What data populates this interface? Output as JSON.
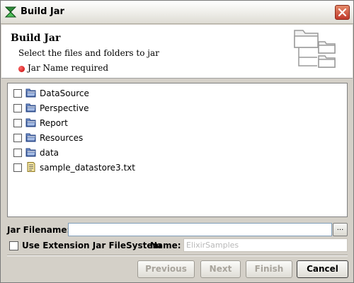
{
  "window": {
    "title": "Build Jar",
    "title_icon": "build-jar-icon",
    "close_icon": "close-icon"
  },
  "header": {
    "title": "Build Jar",
    "description": "Select the files and folders to jar",
    "error": "Jar Name required",
    "error_color": "#c00000",
    "art_icon": "folder-tree-icon"
  },
  "tree": {
    "items": [
      {
        "label": "DataSource",
        "icon": "folder-icon",
        "checked": false
      },
      {
        "label": "Perspective",
        "icon": "folder-icon",
        "checked": false
      },
      {
        "label": "Report",
        "icon": "folder-icon",
        "checked": false
      },
      {
        "label": "Resources",
        "icon": "folder-icon",
        "checked": false
      },
      {
        "label": "data",
        "icon": "folder-icon",
        "checked": false
      },
      {
        "label": "sample_datastore3.txt",
        "icon": "text-file-icon",
        "checked": false
      }
    ]
  },
  "form": {
    "jar_filename_label": "Jar Filename:",
    "jar_filename_value": "",
    "browse_label": "...",
    "use_extension_label": "Use Extension Jar FileSystem",
    "use_extension_checked": false,
    "name_label": "Name:",
    "name_value": "ElixirSamples"
  },
  "buttons": {
    "previous": "Previous",
    "next": "Next",
    "finish": "Finish",
    "cancel": "Cancel"
  }
}
